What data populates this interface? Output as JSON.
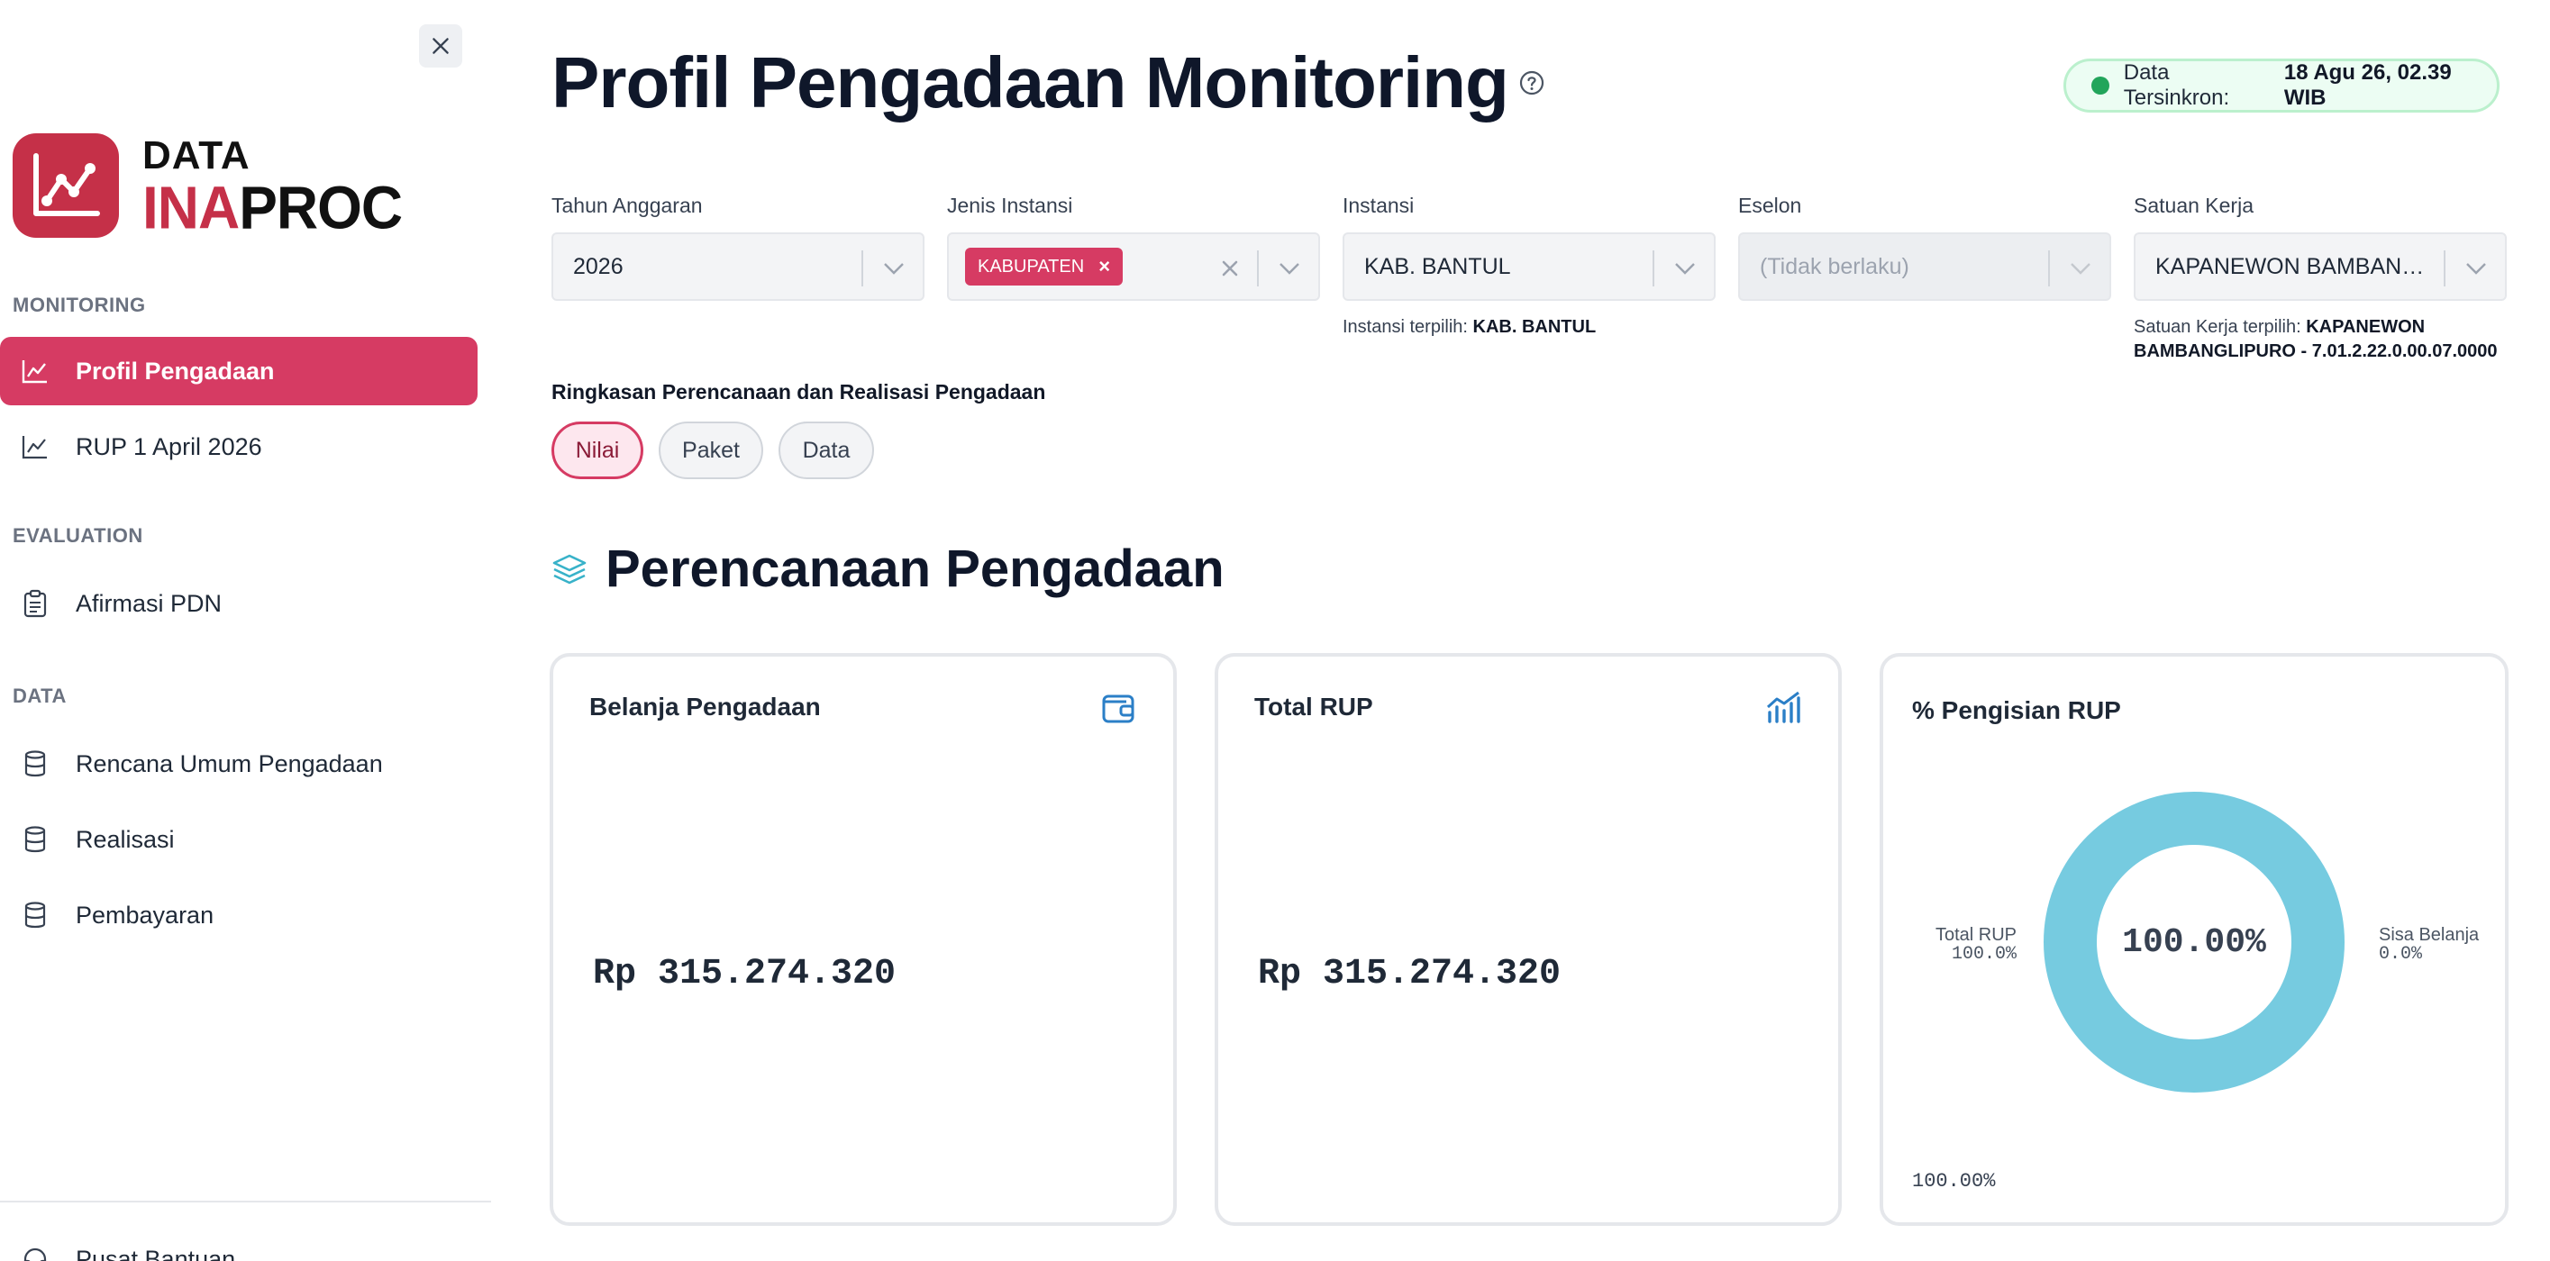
{
  "sidebar": {
    "logo_top": "DATA",
    "logo_ina": "INA",
    "logo_proc": "PROC",
    "sections": [
      {
        "label": "MONITORING"
      },
      {
        "label": "EVALUATION"
      },
      {
        "label": "DATA"
      }
    ],
    "items": [
      {
        "label": "Profil Pengadaan",
        "icon": "line-chart-icon",
        "active": true
      },
      {
        "label": "RUP 1 April 2026",
        "icon": "line-chart-icon",
        "active": false
      },
      {
        "label": "Afirmasi PDN",
        "icon": "clipboard-icon",
        "active": false
      },
      {
        "label": "Rencana Umum Pengadaan",
        "icon": "database-icon",
        "active": false
      },
      {
        "label": "Realisasi",
        "icon": "database-icon",
        "active": false
      },
      {
        "label": "Pembayaran",
        "icon": "database-icon",
        "active": false
      },
      {
        "label": "Pusat Bantuan",
        "icon": "headset-icon",
        "active": false
      }
    ]
  },
  "header": {
    "title": "Profil Pengadaan Monitoring",
    "sync_label": "Data Tersinkron:",
    "sync_value": "18 Agu 26, 02.39 WIB"
  },
  "filters": {
    "tahun": {
      "label": "Tahun Anggaran",
      "value": "2026"
    },
    "jenis": {
      "label": "Jenis Instansi",
      "tag": "KABUPATEN"
    },
    "instansi": {
      "label": "Instansi",
      "value": "KAB. BANTUL",
      "hint_label": "Instansi terpilih:",
      "hint_value": "KAB. BANTUL"
    },
    "eselon": {
      "label": "Eselon",
      "value": "(Tidak berlaku)"
    },
    "satker": {
      "label": "Satuan Kerja",
      "value": "KAPANEWON BAMBANGLIPURO",
      "hint_label": "Satuan Kerja terpilih:",
      "hint_value": "KAPANEWON BAMBANGLIPURO - 7.01.2.22.0.00.07.0000"
    }
  },
  "summary": {
    "label": "Ringkasan Perencanaan dan Realisasi Pengadaan",
    "tabs": [
      "Nilai",
      "Paket",
      "Data"
    ],
    "active_tab": "Nilai"
  },
  "section": {
    "title": "Perencanaan Pengadaan"
  },
  "cards": {
    "belanja": {
      "title": "Belanja Pengadaan",
      "value": "Rp 315.274.320",
      "icon": "wallet-icon"
    },
    "total_rup": {
      "title": "Total RUP",
      "value": "Rp 315.274.320",
      "icon": "bar-trend-icon"
    },
    "pengisian": {
      "title": "% Pengisian RUP",
      "center": "100.00%",
      "footer": "100.00%"
    }
  },
  "chart_data": {
    "type": "pie",
    "title": "% Pengisian RUP",
    "slices": [
      {
        "name": "Total RUP",
        "value": 100.0,
        "label": "100.0%",
        "color": "#76cbe0"
      },
      {
        "name": "Sisa Belanja",
        "value": 0.0,
        "label": "0.0%",
        "color": "#e5e7eb"
      }
    ],
    "center_label": "100.00%"
  },
  "colors": {
    "accent": "#d63b63",
    "brand": "#c53048",
    "donut": "#76cbe0",
    "sync_dot": "#22a55b"
  }
}
